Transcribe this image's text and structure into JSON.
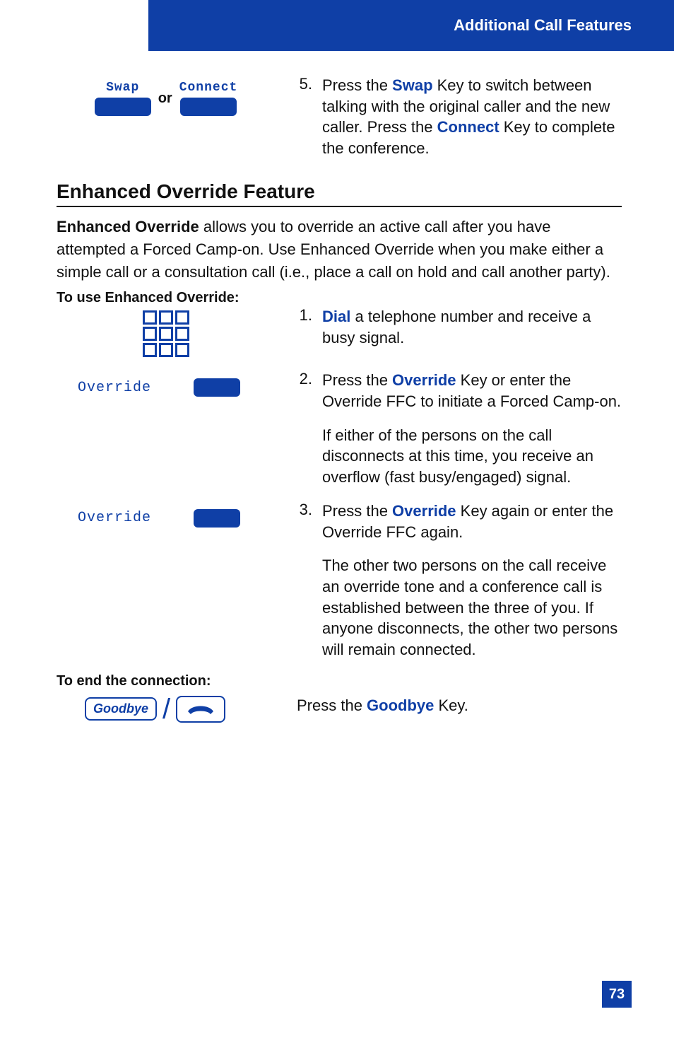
{
  "header": {
    "title": "Additional Call Features"
  },
  "page_number": "73",
  "step5": {
    "left": {
      "key_a_label": "Swap",
      "or": "or",
      "key_b_label": "Connect"
    },
    "num": "5.",
    "text_pre": "Press the ",
    "swap": "Swap",
    "text_mid1": " Key to switch between talking with the original caller and the new caller. Press the ",
    "connect": "Connect",
    "text_end": " Key to complete the conference."
  },
  "section_title": "Enhanced Override Feature",
  "intro": {
    "bold_lead": "Enhanced Override",
    "rest": " allows you to override an active call after you have attempted a Forced Camp-on. Use Enhanced Override when you make either a simple call or a consultation call (i.e., place a call on hold and call another party)."
  },
  "use_heading": "To use Enhanced Override:",
  "step1": {
    "num": "1.",
    "dial": "Dial",
    "rest": " a telephone number and receive a busy signal."
  },
  "step2": {
    "key_label": "Override",
    "num": "2.",
    "pre": "Press the ",
    "override": "Override",
    "rest": " Key or enter the Override FFC to initiate a Forced Camp-on.",
    "sub": "If either of the persons on the call disconnects at this time, you receive an overflow (fast busy/engaged) signal."
  },
  "step3": {
    "key_label": "Override",
    "num": "3.",
    "pre": "Press the ",
    "override": "Override",
    "rest": " Key again or enter the Override FFC again.",
    "sub": "The other two persons on the call receive an override tone and a conference call is established between the three of you. If anyone disconnects, the other two persons will remain connected."
  },
  "end_heading": "To end the connection:",
  "goodbye": {
    "box_label": "Goodbye",
    "text_pre": "Press the ",
    "key": "Goodbye",
    "text_end": " Key."
  }
}
